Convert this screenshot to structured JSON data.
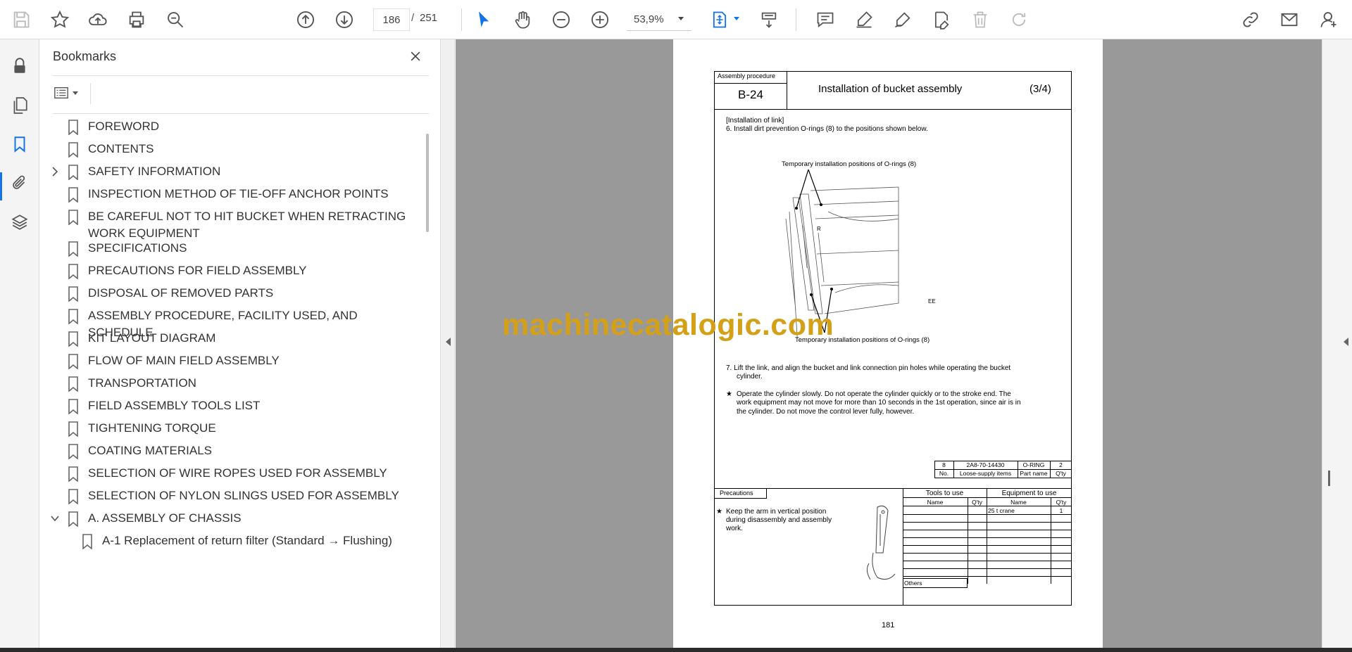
{
  "toolbar": {
    "page_current": "186",
    "page_separator": "/",
    "page_total": "251",
    "zoom": "53,9%",
    "icons": [
      "save-icon",
      "star-icon",
      "upload-icon",
      "print-icon",
      "zoom-search-icon",
      "page-up-icon",
      "page-down-icon",
      "select-cursor-icon",
      "hand-icon",
      "zoom-out-icon",
      "zoom-in-icon",
      "fit-page-icon",
      "scroll-mode-icon",
      "comment-icon",
      "highlight-icon",
      "sign-icon",
      "edit-icon",
      "delete-icon",
      "redo-icon",
      "link-icon",
      "email-icon",
      "account-icon"
    ]
  },
  "rail": {
    "icons": [
      "lock-icon",
      "pages-icon",
      "bookmark-icon",
      "attachment-icon",
      "layers-icon"
    ]
  },
  "bookmarks": {
    "title": "Bookmarks",
    "items": [
      {
        "label": "FOREWORD",
        "chevron": ""
      },
      {
        "label": "CONTENTS",
        "chevron": ""
      },
      {
        "label": "SAFETY INFORMATION",
        "chevron": "right"
      },
      {
        "label": "INSPECTION METHOD OF TIE-OFF ANCHOR POINTS",
        "chevron": ""
      },
      {
        "label": "BE CAREFUL NOT TO HIT BUCKET WHEN RETRACTING WORK EQUIPMENT",
        "chevron": ""
      },
      {
        "label": "SPECIFICATIONS",
        "chevron": ""
      },
      {
        "label": "PRECAUTIONS FOR FIELD ASSEMBLY",
        "chevron": ""
      },
      {
        "label": "DISPOSAL OF REMOVED PARTS",
        "chevron": ""
      },
      {
        "label": "ASSEMBLY PROCEDURE, FACILITY USED, AND SCHEDULE",
        "chevron": ""
      },
      {
        "label": "KIT LAYOUT DIAGRAM",
        "chevron": ""
      },
      {
        "label": "FLOW OF MAIN FIELD ASSEMBLY",
        "chevron": ""
      },
      {
        "label": "TRANSPORTATION",
        "chevron": ""
      },
      {
        "label": "FIELD ASSEMBLY TOOLS LIST",
        "chevron": ""
      },
      {
        "label": "TIGHTENING TORQUE",
        "chevron": ""
      },
      {
        "label": "COATING MATERIALS",
        "chevron": ""
      },
      {
        "label": "SELECTION OF WIRE ROPES USED FOR ASSEMBLY",
        "chevron": ""
      },
      {
        "label": "SELECTION OF NYLON SLINGS USED FOR ASSEMBLY",
        "chevron": ""
      },
      {
        "label": "A. ASSEMBLY OF CHASSIS",
        "chevron": "down"
      },
      {
        "label": "A-1 Replacement of return filter (Standard → Flushing)",
        "chevron": "",
        "sub": true
      }
    ]
  },
  "document": {
    "proc_label": "Assembly procedure",
    "proc_no": "B-24",
    "title": "Installation of bucket assembly",
    "part": "(3/4)",
    "section": "[Installation of link]",
    "step6": "6.  Install dirt prevention O-rings (8) to the positions shown below.",
    "fig_label_top": "Temporary installation positions of O-rings (8)",
    "fig_label_bottom": "Temporary installation positions of O-rings (8)",
    "fig_ee": "EE",
    "fig_r": "R",
    "step7_line1": "7.  Lift the link, and align the bucket and link connection pin holes while operating the bucket",
    "step7_line2": "cylinder.",
    "note_star": "★",
    "note_line1": "Operate the cylinder slowly. Do not operate the cylinder quickly or to the stroke end. The",
    "note_line2": "work equipment may not move for more than 10 seconds in the 1st operation, since air is in",
    "note_line3": "the cylinder. Do not move the control lever fully, however.",
    "parts_row": {
      "no": "8",
      "item": "2A8-70-14430",
      "name": "O-RING",
      "qty": "2"
    },
    "parts_header": {
      "no": "No.",
      "item": "Loose-supply items",
      "name": "Part name",
      "qty": "Q'ty"
    },
    "precautions_label": "Precautions",
    "precaution_star": "★",
    "precaution_line1": "Keep the arm in vertical position",
    "precaution_line2": "during disassembly and assembly",
    "precaution_line3": "work.",
    "tools_header": "Tools to use",
    "equip_header": "Equipment to use",
    "col_name": "Name",
    "col_qty": "Q'ty",
    "equip_row1_name": "25 t crane",
    "equip_row1_qty": "1",
    "others_label": "Others",
    "page_number": "181"
  },
  "watermark": "machinecatalogic.com"
}
